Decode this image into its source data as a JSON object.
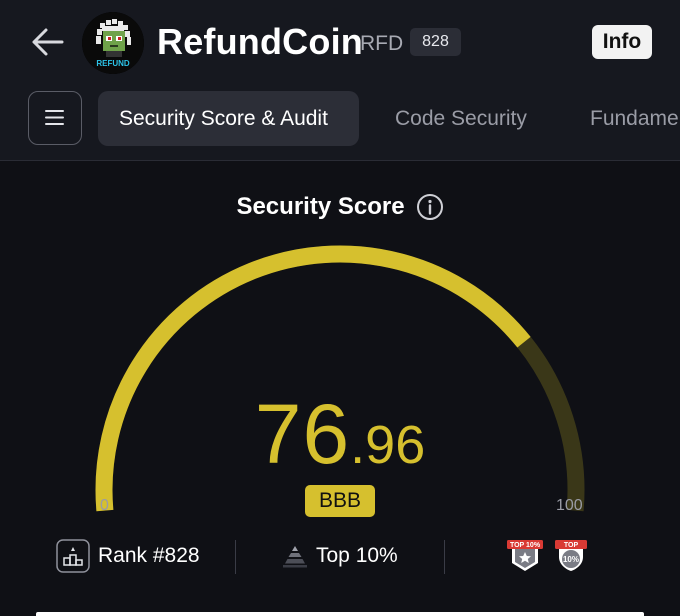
{
  "header": {
    "title": "RefundCoin",
    "symbol": "RFD",
    "rank_badge": "828",
    "info_label": "Info",
    "avatar_text": "REFUND"
  },
  "tabs": [
    {
      "label": "Security Score & Audit",
      "active": true
    },
    {
      "label": "Code Security",
      "active": false
    },
    {
      "label": "Fundame",
      "active": false
    }
  ],
  "score": {
    "title": "Security Score",
    "integer": "76",
    "decimal": ".96",
    "value": 76.96,
    "grade": "BBB",
    "min_label": "0",
    "max_label": "100"
  },
  "stats": {
    "rank": "Rank #828",
    "top": "Top 10%",
    "badge1_text": "TOP 10%",
    "badge2_line1": "TOP",
    "badge2_line2": "10%"
  },
  "colors": {
    "accent": "#d6c02e",
    "accent_dim": "#3a3718",
    "background": "#0f1015",
    "header_bg": "#16181f",
    "badge_red": "#d93a34"
  },
  "icons": {
    "back": "back-arrow-icon",
    "menu": "menu-icon",
    "info": "info-icon",
    "rank": "podium-icon",
    "top": "pyramid-icon"
  }
}
